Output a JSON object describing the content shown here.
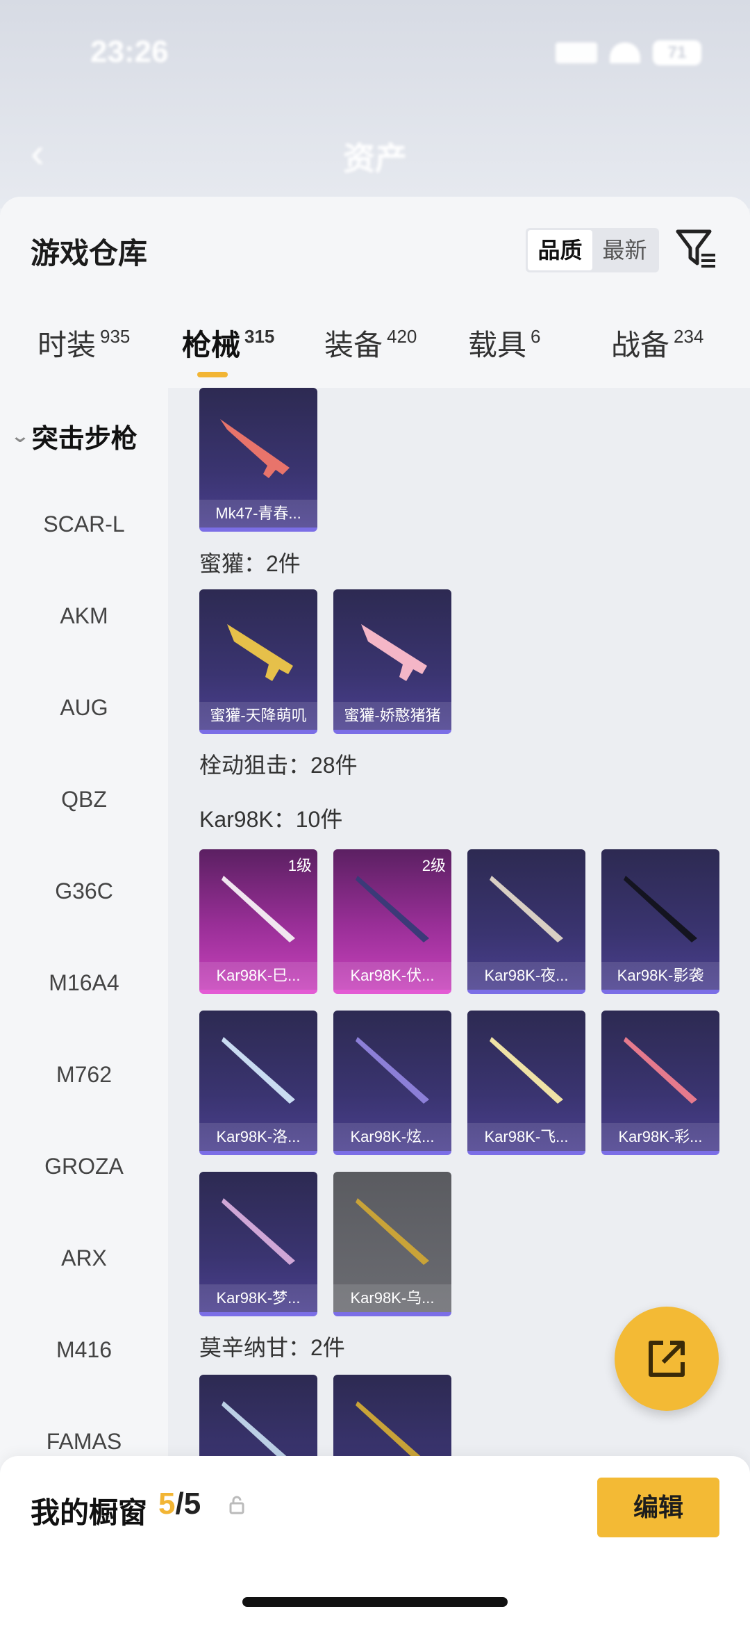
{
  "status_bar": {
    "time": "23:26",
    "battery": "71"
  },
  "nav": {
    "back_glyph": "‹",
    "title": "资产"
  },
  "sheet": {
    "title": "游戏仓库",
    "sort_options": [
      "品质",
      "最新"
    ],
    "sort_selected": "品质"
  },
  "tabs": [
    {
      "label": "时装",
      "count": "935"
    },
    {
      "label": "枪械",
      "count": "315",
      "active": true
    },
    {
      "label": "装备",
      "count": "420"
    },
    {
      "label": "载具",
      "count": "6"
    },
    {
      "label": "战备",
      "count": "234"
    }
  ],
  "sidebar": {
    "group": "突击步枪",
    "items": [
      "SCAR-L",
      "AKM",
      "AUG",
      "QBZ",
      "G36C",
      "M16A4",
      "M762",
      "GROZA",
      "ARX",
      "M416",
      "FAMAS"
    ]
  },
  "sections": {
    "s1": "蜜獾：2件",
    "s2": "栓动狙击：28件",
    "s3": "Kar98K：10件",
    "s4": "莫辛纳甘：2件"
  },
  "cards": {
    "mk47": "Mk47-青春...",
    "honey1": "蜜獾-天降萌叽",
    "honey2": "蜜獾-娇憨猪猪",
    "k1": "Kar98K-巳...",
    "k1_level": "1级",
    "k2": "Kar98K-伏...",
    "k2_level": "2级",
    "k3": "Kar98K-夜...",
    "k4": "Kar98K-影袭",
    "k5": "Kar98K-洛...",
    "k6": "Kar98K-炫...",
    "k7": "Kar98K-飞...",
    "k8": "Kar98K-彩...",
    "k9": "Kar98K-梦...",
    "k10": "Kar98K-乌..."
  },
  "showcase": {
    "label": "我的橱窗",
    "current": "5",
    "total": "/5",
    "edit_label": "编辑"
  },
  "colors": {
    "accent": "#f3ba35",
    "card_purple": "#3a3470",
    "card_pink": "#9a2f98"
  }
}
